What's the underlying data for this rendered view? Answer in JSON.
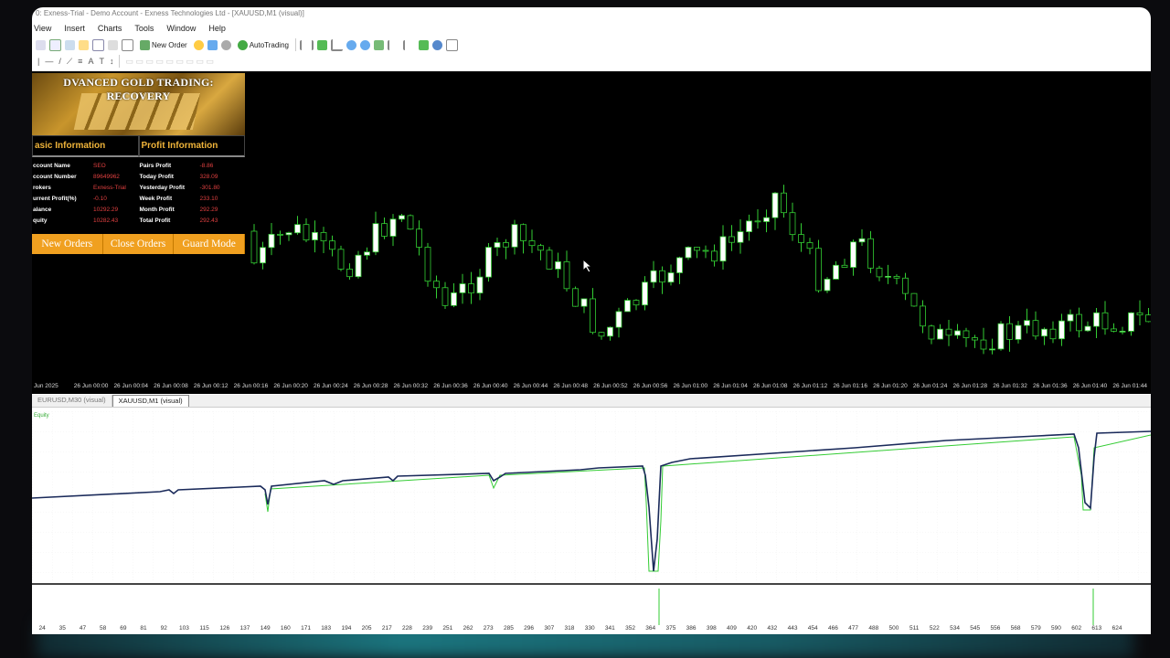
{
  "window": {
    "title": "0: Exness-Trial - Demo Account - Exness Technologies Ltd - [XAUUSD,M1 (visual)]"
  },
  "menu": [
    "View",
    "Insert",
    "Charts",
    "Tools",
    "Window",
    "Help"
  ],
  "toolbar": {
    "new_order": "New Order",
    "auto_trading": "AutoTrading"
  },
  "panel": {
    "title": "DVANCED GOLD TRADING: RECOVERY",
    "basic_header": "asic Information",
    "profit_header": "Profit Information",
    "basic": [
      {
        "k": "ccount Name",
        "v": "SEO"
      },
      {
        "k": "ccount Number",
        "v": "89649962"
      },
      {
        "k": "rokers",
        "v": "Exness-Trial"
      },
      {
        "k": "urrent Profit(%)",
        "v": "-0.10"
      },
      {
        "k": "alance",
        "v": "10292.29"
      },
      {
        "k": "quity",
        "v": "10282.43"
      }
    ],
    "profit": [
      {
        "k": "Pairs Profit",
        "v": "-8.86"
      },
      {
        "k": "Today Profit",
        "v": "328.09"
      },
      {
        "k": "Yesterday Profit",
        "v": "-301.80"
      },
      {
        "k": "Week Profit",
        "v": "233.10"
      },
      {
        "k": "Month Profit",
        "v": "292.29"
      },
      {
        "k": "Total Profit",
        "v": "292.43"
      }
    ],
    "buttons": [
      "New Orders",
      "Close Orders",
      "Guard Mode"
    ]
  },
  "time_axis": [
    "Jun 2025",
    "26 Jun 00:00",
    "26 Jun 00:04",
    "26 Jun 00:08",
    "26 Jun 00:12",
    "26 Jun 00:16",
    "26 Jun 00:20",
    "26 Jun 00:24",
    "26 Jun 00:28",
    "26 Jun 00:32",
    "26 Jun 00:36",
    "26 Jun 00:40",
    "26 Jun 00:44",
    "26 Jun 00:48",
    "26 Jun 00:52",
    "26 Jun 00:56",
    "26 Jun 01:00",
    "26 Jun 01:04",
    "26 Jun 01:08",
    "26 Jun 01:12",
    "26 Jun 01:16",
    "26 Jun 01:20",
    "26 Jun 01:24",
    "26 Jun 01:28",
    "26 Jun 01:32",
    "26 Jun 01:36",
    "26 Jun 01:40",
    "26 Jun 01:44"
  ],
  "tabs": [
    {
      "label": "EURUSD,M30 (visual)",
      "active": false
    },
    {
      "label": "XAUUSD,M1 (visual)",
      "active": true
    }
  ],
  "equity_label": "Equity",
  "trade_axis": [
    "24",
    "35",
    "47",
    "58",
    "69",
    "81",
    "92",
    "103",
    "115",
    "126",
    "137",
    "149",
    "160",
    "171",
    "183",
    "194",
    "205",
    "217",
    "228",
    "239",
    "251",
    "262",
    "273",
    "285",
    "296",
    "307",
    "318",
    "330",
    "341",
    "352",
    "364",
    "375",
    "386",
    "398",
    "409",
    "420",
    "432",
    "443",
    "454",
    "466",
    "477",
    "488",
    "500",
    "511",
    "522",
    "534",
    "545",
    "556",
    "568",
    "579",
    "590",
    "602",
    "613",
    "624"
  ],
  "colors": {
    "panel_accent": "#f0b43a",
    "button_bg": "#f0a020",
    "bull_candle": "#ffffff",
    "bear_candle": "#000000",
    "wick": "#33cc33",
    "equity_line": "#1a2a5a"
  }
}
